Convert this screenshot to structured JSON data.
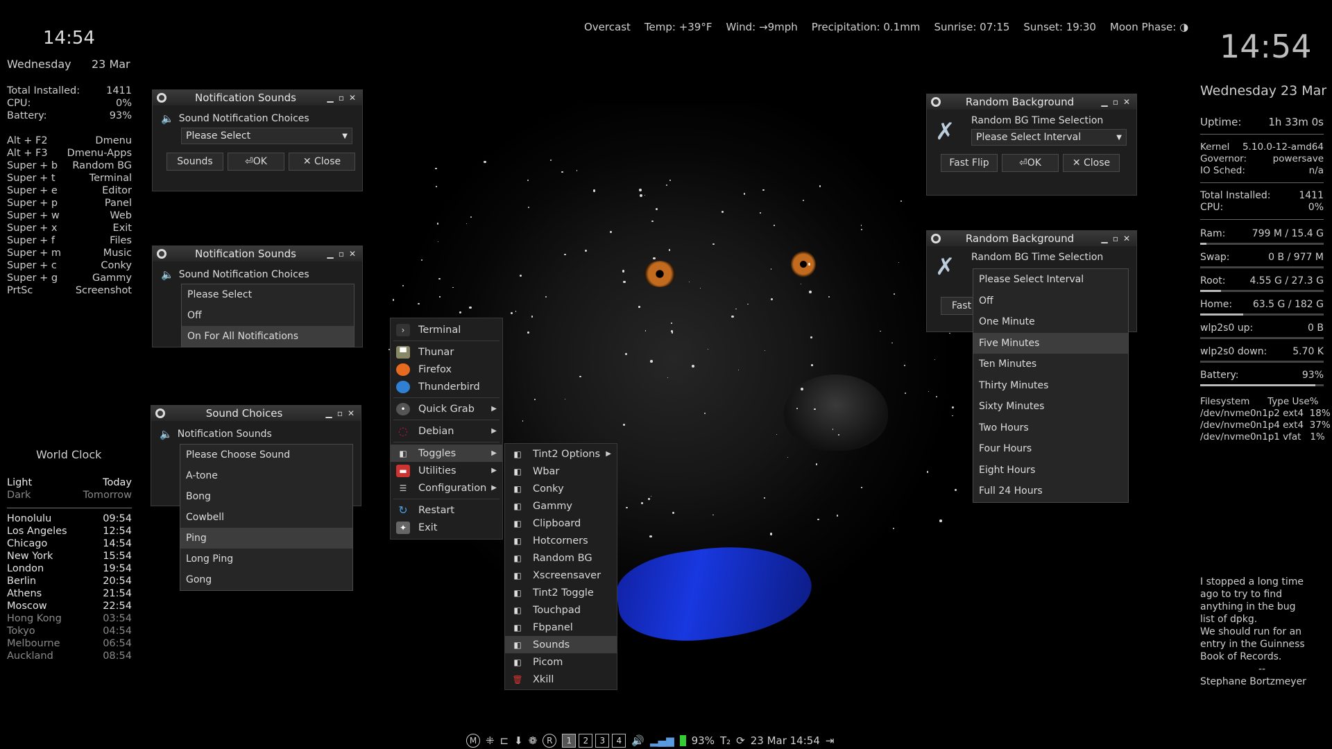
{
  "left_clock": {
    "time": "14:54",
    "day": "Wednesday",
    "date": "23 Mar"
  },
  "left_stats": [
    {
      "k": "Total Installed:",
      "v": "1411"
    },
    {
      "k": "CPU:",
      "v": "0%"
    },
    {
      "k": "Battery:",
      "v": "93%"
    }
  ],
  "shortcuts": [
    {
      "k": "Alt + F2",
      "v": "Dmenu"
    },
    {
      "k": "Alt + F3",
      "v": "Dmenu-Apps"
    },
    {
      "k": "Super + b",
      "v": "Random BG"
    },
    {
      "k": "Super + t",
      "v": "Terminal"
    },
    {
      "k": "Super + e",
      "v": "Editor"
    },
    {
      "k": "Super + p",
      "v": "Panel"
    },
    {
      "k": "Super + w",
      "v": "Web"
    },
    {
      "k": "Super + x",
      "v": "Exit"
    },
    {
      "k": "Super + f",
      "v": "Files"
    },
    {
      "k": "Super + m",
      "v": "Music"
    },
    {
      "k": "Super + c",
      "v": "Conky"
    },
    {
      "k": "Super + g",
      "v": "Gammy"
    },
    {
      "k": "PrtSc",
      "v": "Screenshot"
    }
  ],
  "world_clock": {
    "title": "World Clock",
    "h1": "Light",
    "h1r": "Today",
    "h2": "Dark",
    "h2r": "Tomorrow",
    "cities": [
      {
        "k": "Honolulu",
        "v": "09:54",
        "light": true
      },
      {
        "k": "Los Angeles",
        "v": "12:54",
        "light": true
      },
      {
        "k": "Chicago",
        "v": "14:54",
        "light": true
      },
      {
        "k": "New York",
        "v": "15:54",
        "light": true
      },
      {
        "k": "London",
        "v": "19:54",
        "light": true
      },
      {
        "k": "Berlin",
        "v": "20:54",
        "light": true
      },
      {
        "k": "Athens",
        "v": "21:54",
        "light": true
      },
      {
        "k": "Moscow",
        "v": "22:54",
        "light": true
      },
      {
        "k": "Hong Kong",
        "v": "03:54",
        "light": false
      },
      {
        "k": "Tokyo",
        "v": "04:54",
        "light": false
      },
      {
        "k": "Melbourne",
        "v": "06:54",
        "light": false
      },
      {
        "k": "Auckland",
        "v": "08:54",
        "light": false
      }
    ]
  },
  "weather": {
    "condition": "Overcast",
    "temp": "Temp: +39°F",
    "wind": "Wind: →9mph",
    "precip": "Precipitation: 0.1mm",
    "sunrise": "Sunrise: 07:15",
    "sunset": "Sunset: 19:30",
    "moon": "Moon Phase: ◑"
  },
  "ns1": {
    "title": "Notification Sounds",
    "label": "Sound Notification Choices",
    "select": "Please Select",
    "b1": "Sounds",
    "b2": "OK",
    "b3": "✕ Close"
  },
  "ns2": {
    "title": "Notification Sounds",
    "label": "Sound Notification Choices",
    "options": [
      "Please Select",
      "Off",
      "On For All Notifications"
    ],
    "hl": 2
  },
  "sc": {
    "title": "Sound Choices",
    "label": "Notification Sounds",
    "options": [
      "Please Choose Sound",
      "A-tone",
      "Bong",
      "Cowbell",
      "Ping",
      "Long Ping",
      "Gong"
    ],
    "hl": 4
  },
  "rb1": {
    "title": "Random Background",
    "label": "Random BG Time Selection",
    "select": "Please Select Interval",
    "b1": "Fast Flip",
    "b2": "OK",
    "b3": "✕ Close"
  },
  "rb2": {
    "title": "Random Background",
    "label": "Random BG Time Selection",
    "fast": "Fast",
    "options": [
      "Please Select Interval",
      "Off",
      "One Minute",
      "Five Minutes",
      "Ten Minutes",
      "Thirty Minutes",
      "Sixty Minutes",
      "Two Hours",
      "Four Hours",
      "Eight Hours",
      "Full 24 Hours"
    ],
    "hl": 3
  },
  "menu": {
    "terminal": "Terminal",
    "thunar": "Thunar",
    "firefox": "Firefox",
    "thunderbird": "Thunderbird",
    "quickgrab": "Quick Grab",
    "debian": "Debian",
    "toggles": "Toggles",
    "utilities": "Utilities",
    "configuration": "Configuration",
    "restart": "Restart",
    "exit": "Exit"
  },
  "submenu": [
    "Tint2 Options",
    "Wbar",
    "Conky",
    "Gammy",
    "Clipboard",
    "Hotcorners",
    "Random BG",
    "Xscreensaver",
    "Tint2 Toggle",
    "Touchpad",
    "Fbpanel",
    "Sounds",
    "Picom",
    "Xkill"
  ],
  "right": {
    "time": "14:54",
    "date": "Wednesday 23 Mar",
    "uptime_k": "Uptime:",
    "uptime_v": "1h 33m 0s",
    "sys": [
      {
        "k": "Kernel",
        "v": "5.10.0-12-amd64"
      },
      {
        "k": "Governor:",
        "v": "powersave"
      },
      {
        "k": "IO Sched:",
        "v": "n/a"
      }
    ],
    "inst": [
      {
        "k": "Total Installed:",
        "v": "1411"
      },
      {
        "k": "CPU:",
        "v": "0%"
      }
    ],
    "bars": [
      {
        "k": "Ram:",
        "v": "799 M  / 15.4 G",
        "fill": 0.05
      },
      {
        "k": "Swap:",
        "v": "0 B  / 977 M",
        "fill": 0.0
      },
      {
        "k": "Root:",
        "v": "4.55 G / 27.3 G",
        "fill": 0.17
      },
      {
        "k": "Home:",
        "v": "63.5 G / 182 G",
        "fill": 0.35
      },
      {
        "k": "wlp2s0 up:",
        "v": "0 B",
        "fill": 0.0
      },
      {
        "k": "wlp2s0 down:",
        "v": "5.70 K",
        "fill": 0.0
      },
      {
        "k": "Battery:",
        "v": "93%",
        "fill": 0.93
      }
    ],
    "fs_header": "Filesystem      Type Use%",
    "fs": [
      "/dev/nvme0n1p2 ext4  18%",
      "/dev/nvme0n1p4 ext4  37%",
      "/dev/nvme0n1p1 vfat   1%"
    ],
    "quote": [
      "I stopped a long time",
      "ago to try to find",
      "anything in the bug",
      "list of dpkg.",
      "We should run for an",
      "entry in the Guinness",
      "Book of Records.",
      "--",
      "Stephane Bortzmeyer"
    ]
  },
  "taskbar": {
    "workspaces": [
      "1",
      "2",
      "3",
      "4"
    ],
    "battery": "93%",
    "clock": "23 Mar 14:54"
  }
}
